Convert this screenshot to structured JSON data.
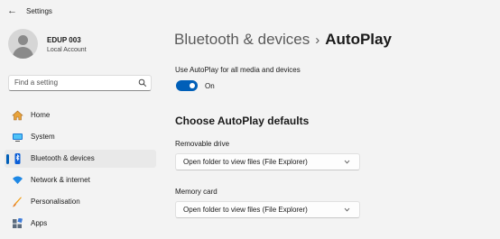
{
  "window": {
    "title": "Settings"
  },
  "user": {
    "name": "EDUP 003",
    "account_type": "Local Account"
  },
  "search": {
    "placeholder": "Find a setting"
  },
  "nav": {
    "items": [
      {
        "label": "Home",
        "icon": "home-icon"
      },
      {
        "label": "System",
        "icon": "system-icon"
      },
      {
        "label": "Bluetooth & devices",
        "icon": "bluetooth-icon",
        "selected": true
      },
      {
        "label": "Network & internet",
        "icon": "wifi-icon"
      },
      {
        "label": "Personalisation",
        "icon": "brush-icon"
      },
      {
        "label": "Apps",
        "icon": "apps-icon"
      }
    ]
  },
  "header": {
    "parent": "Bluetooth & devices",
    "separator": "›",
    "current": "AutoPlay"
  },
  "autoplay": {
    "toggle_label": "Use AutoPlay for all media and devices",
    "toggle_state": "On",
    "enabled": true
  },
  "defaults": {
    "heading": "Choose AutoPlay defaults",
    "removable_drive": {
      "label": "Removable drive",
      "value": "Open folder to view files (File Explorer)"
    },
    "memory_card": {
      "label": "Memory card",
      "value": "Open folder to view files (File Explorer)"
    }
  },
  "colors": {
    "accent": "#005fb8",
    "background": "#f3f3f3",
    "selected_nav": "#e9e9e9"
  }
}
